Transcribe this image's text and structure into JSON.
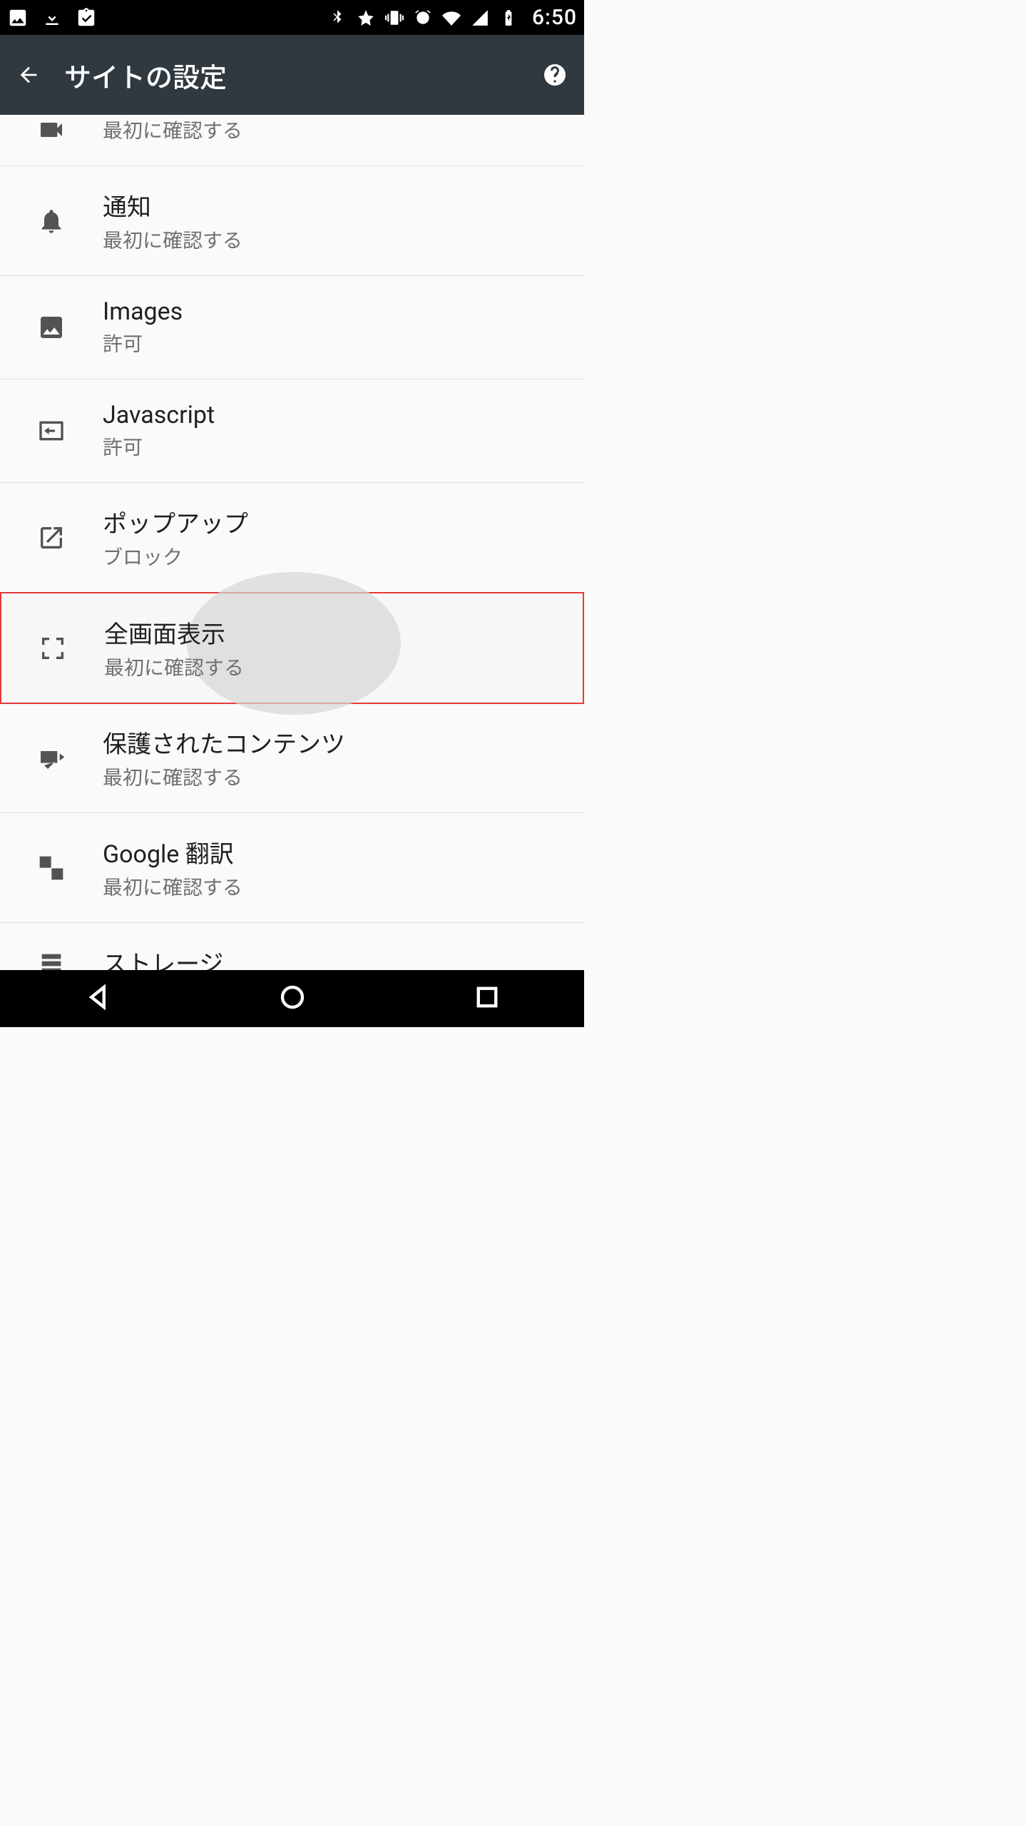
{
  "status": {
    "time": "6:50"
  },
  "appbar": {
    "title": "サイトの設定"
  },
  "rows": {
    "camera": {
      "title": "",
      "sub": "最初に確認する"
    },
    "notif": {
      "title": "通知",
      "sub": "最初に確認する"
    },
    "images": {
      "title": "Images",
      "sub": "許可"
    },
    "javascript": {
      "title": "Javascript",
      "sub": "許可"
    },
    "popup": {
      "title": "ポップアップ",
      "sub": "ブロック"
    },
    "fullscreen": {
      "title": "全画面表示",
      "sub": "最初に確認する"
    },
    "protected": {
      "title": "保護されたコンテンツ",
      "sub": "最初に確認する"
    },
    "translate": {
      "title": "Google 翻訳",
      "sub": "最初に確認する"
    },
    "storage": {
      "title": "ストレージ",
      "sub": ""
    }
  }
}
